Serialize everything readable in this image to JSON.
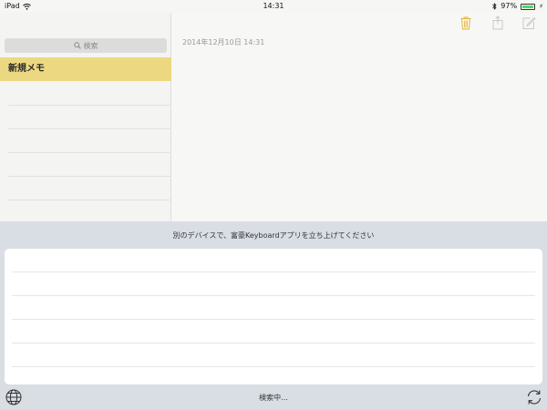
{
  "status_bar": {
    "device": "iPad",
    "time": "14:31",
    "battery_percent": "97%",
    "battery_level": 0.97
  },
  "sidebar": {
    "search_placeholder": "検索",
    "selected_note_title": "新規メモ"
  },
  "note": {
    "date": "2014年12月10日 14:31"
  },
  "toolbar": {
    "icons": [
      "trash-icon",
      "share-icon",
      "compose-icon"
    ],
    "accent_color": "#e3b53a"
  },
  "keyboard_panel": {
    "message": "別のデバイスで、富豪Keyboardアプリを立ち上げてください",
    "status": "検索中..."
  }
}
